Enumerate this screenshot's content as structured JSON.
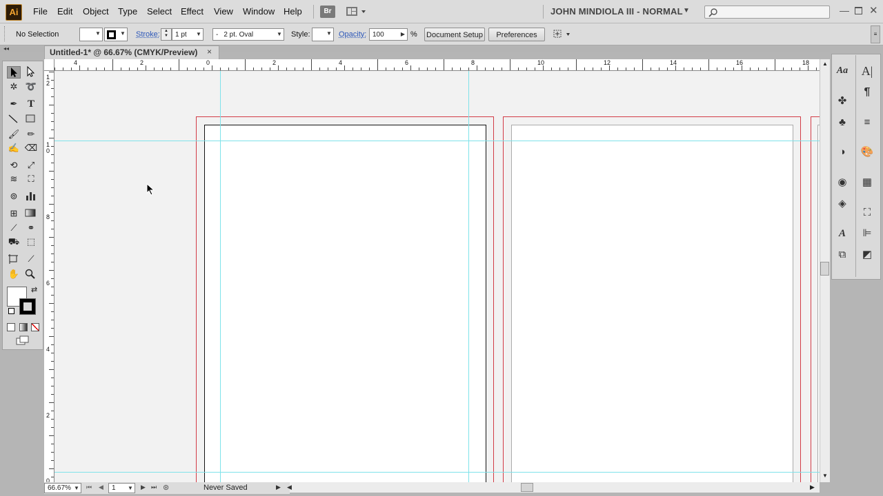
{
  "app": {
    "logo_text": "Ai"
  },
  "menu": [
    "File",
    "Edit",
    "Object",
    "Type",
    "Select",
    "Effect",
    "View",
    "Window",
    "Help"
  ],
  "menubar_extras": {
    "bridge_label": "Br",
    "workspace": "JOHN MINDIOLA III - NORMAL",
    "search_placeholder": ""
  },
  "control_bar": {
    "selection": "No Selection",
    "stroke_label": "Stroke:",
    "stroke_weight": "1 pt",
    "brush": "2 pt. Oval",
    "brush_prefix": "-",
    "style_label": "Style:",
    "opacity_label": "Opacity:",
    "opacity_value": "100",
    "opacity_unit": "%",
    "document_setup": "Document Setup",
    "preferences": "Preferences"
  },
  "document": {
    "tab_title": "Untitled-1* @ 66.67% (CMYK/Preview)",
    "close": "×"
  },
  "rulers": {
    "horizontal": [
      "4",
      "2",
      "0",
      "2",
      "4",
      "6",
      "8",
      "10",
      "12",
      "14",
      "16",
      "18"
    ],
    "vertical": [
      "1 2",
      "1 0",
      "8",
      "6",
      "4",
      "2",
      "0"
    ]
  },
  "status_bar": {
    "zoom": "66.67%",
    "artboard_number": "1",
    "status": "Never Saved"
  },
  "colors": {
    "bleed": "#d23a45",
    "guide": "#7ee2ea",
    "canvas": "#f2f2f2",
    "chrome": "#dcdcdc",
    "logo_bg": "#2e1c07",
    "logo_fg": "#f4a531"
  },
  "tools": [
    "selection",
    "direct-selection",
    "magic-wand",
    "lasso",
    "pen",
    "type",
    "line-segment",
    "rectangle",
    "paintbrush",
    "pencil",
    "blob-brush",
    "eraser",
    "rotate",
    "scale",
    "warp",
    "free-transform",
    "symbol-sprayer",
    "column-graph",
    "mesh",
    "gradient",
    "eyedropper",
    "blend",
    "live-paint-bucket",
    "live-paint-selection",
    "artboard",
    "slice",
    "hand",
    "zoom"
  ],
  "dock_icons": [
    "character",
    "paragraph-styles",
    "paragraph",
    "brushes",
    "symbols",
    "stroke",
    "transparency",
    "color",
    "appearance",
    "swatches",
    "layers",
    "transform",
    "character-styles",
    "align",
    "graphic-styles",
    "pathfinder"
  ]
}
